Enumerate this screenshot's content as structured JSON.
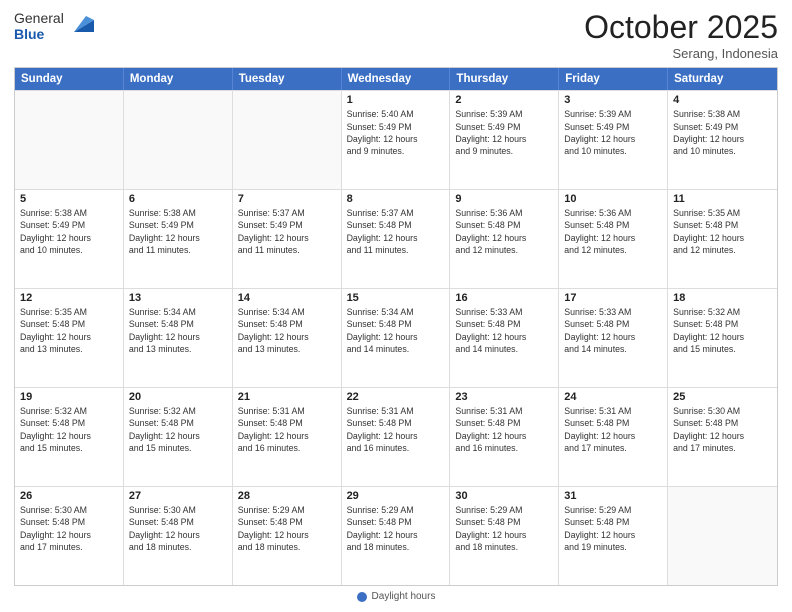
{
  "header": {
    "logo_general": "General",
    "logo_blue": "Blue",
    "month_title": "October 2025",
    "location": "Serang, Indonesia"
  },
  "days_of_week": [
    "Sunday",
    "Monday",
    "Tuesday",
    "Wednesday",
    "Thursday",
    "Friday",
    "Saturday"
  ],
  "footer": {
    "daylight_label": "Daylight hours"
  },
  "rows": [
    [
      {
        "day": "",
        "lines": []
      },
      {
        "day": "",
        "lines": []
      },
      {
        "day": "",
        "lines": []
      },
      {
        "day": "1",
        "lines": [
          "Sunrise: 5:40 AM",
          "Sunset: 5:49 PM",
          "Daylight: 12 hours",
          "and 9 minutes."
        ]
      },
      {
        "day": "2",
        "lines": [
          "Sunrise: 5:39 AM",
          "Sunset: 5:49 PM",
          "Daylight: 12 hours",
          "and 9 minutes."
        ]
      },
      {
        "day": "3",
        "lines": [
          "Sunrise: 5:39 AM",
          "Sunset: 5:49 PM",
          "Daylight: 12 hours",
          "and 10 minutes."
        ]
      },
      {
        "day": "4",
        "lines": [
          "Sunrise: 5:38 AM",
          "Sunset: 5:49 PM",
          "Daylight: 12 hours",
          "and 10 minutes."
        ]
      }
    ],
    [
      {
        "day": "5",
        "lines": [
          "Sunrise: 5:38 AM",
          "Sunset: 5:49 PM",
          "Daylight: 12 hours",
          "and 10 minutes."
        ]
      },
      {
        "day": "6",
        "lines": [
          "Sunrise: 5:38 AM",
          "Sunset: 5:49 PM",
          "Daylight: 12 hours",
          "and 11 minutes."
        ]
      },
      {
        "day": "7",
        "lines": [
          "Sunrise: 5:37 AM",
          "Sunset: 5:49 PM",
          "Daylight: 12 hours",
          "and 11 minutes."
        ]
      },
      {
        "day": "8",
        "lines": [
          "Sunrise: 5:37 AM",
          "Sunset: 5:48 PM",
          "Daylight: 12 hours",
          "and 11 minutes."
        ]
      },
      {
        "day": "9",
        "lines": [
          "Sunrise: 5:36 AM",
          "Sunset: 5:48 PM",
          "Daylight: 12 hours",
          "and 12 minutes."
        ]
      },
      {
        "day": "10",
        "lines": [
          "Sunrise: 5:36 AM",
          "Sunset: 5:48 PM",
          "Daylight: 12 hours",
          "and 12 minutes."
        ]
      },
      {
        "day": "11",
        "lines": [
          "Sunrise: 5:35 AM",
          "Sunset: 5:48 PM",
          "Daylight: 12 hours",
          "and 12 minutes."
        ]
      }
    ],
    [
      {
        "day": "12",
        "lines": [
          "Sunrise: 5:35 AM",
          "Sunset: 5:48 PM",
          "Daylight: 12 hours",
          "and 13 minutes."
        ]
      },
      {
        "day": "13",
        "lines": [
          "Sunrise: 5:34 AM",
          "Sunset: 5:48 PM",
          "Daylight: 12 hours",
          "and 13 minutes."
        ]
      },
      {
        "day": "14",
        "lines": [
          "Sunrise: 5:34 AM",
          "Sunset: 5:48 PM",
          "Daylight: 12 hours",
          "and 13 minutes."
        ]
      },
      {
        "day": "15",
        "lines": [
          "Sunrise: 5:34 AM",
          "Sunset: 5:48 PM",
          "Daylight: 12 hours",
          "and 14 minutes."
        ]
      },
      {
        "day": "16",
        "lines": [
          "Sunrise: 5:33 AM",
          "Sunset: 5:48 PM",
          "Daylight: 12 hours",
          "and 14 minutes."
        ]
      },
      {
        "day": "17",
        "lines": [
          "Sunrise: 5:33 AM",
          "Sunset: 5:48 PM",
          "Daylight: 12 hours",
          "and 14 minutes."
        ]
      },
      {
        "day": "18",
        "lines": [
          "Sunrise: 5:32 AM",
          "Sunset: 5:48 PM",
          "Daylight: 12 hours",
          "and 15 minutes."
        ]
      }
    ],
    [
      {
        "day": "19",
        "lines": [
          "Sunrise: 5:32 AM",
          "Sunset: 5:48 PM",
          "Daylight: 12 hours",
          "and 15 minutes."
        ]
      },
      {
        "day": "20",
        "lines": [
          "Sunrise: 5:32 AM",
          "Sunset: 5:48 PM",
          "Daylight: 12 hours",
          "and 15 minutes."
        ]
      },
      {
        "day": "21",
        "lines": [
          "Sunrise: 5:31 AM",
          "Sunset: 5:48 PM",
          "Daylight: 12 hours",
          "and 16 minutes."
        ]
      },
      {
        "day": "22",
        "lines": [
          "Sunrise: 5:31 AM",
          "Sunset: 5:48 PM",
          "Daylight: 12 hours",
          "and 16 minutes."
        ]
      },
      {
        "day": "23",
        "lines": [
          "Sunrise: 5:31 AM",
          "Sunset: 5:48 PM",
          "Daylight: 12 hours",
          "and 16 minutes."
        ]
      },
      {
        "day": "24",
        "lines": [
          "Sunrise: 5:31 AM",
          "Sunset: 5:48 PM",
          "Daylight: 12 hours",
          "and 17 minutes."
        ]
      },
      {
        "day": "25",
        "lines": [
          "Sunrise: 5:30 AM",
          "Sunset: 5:48 PM",
          "Daylight: 12 hours",
          "and 17 minutes."
        ]
      }
    ],
    [
      {
        "day": "26",
        "lines": [
          "Sunrise: 5:30 AM",
          "Sunset: 5:48 PM",
          "Daylight: 12 hours",
          "and 17 minutes."
        ]
      },
      {
        "day": "27",
        "lines": [
          "Sunrise: 5:30 AM",
          "Sunset: 5:48 PM",
          "Daylight: 12 hours",
          "and 18 minutes."
        ]
      },
      {
        "day": "28",
        "lines": [
          "Sunrise: 5:29 AM",
          "Sunset: 5:48 PM",
          "Daylight: 12 hours",
          "and 18 minutes."
        ]
      },
      {
        "day": "29",
        "lines": [
          "Sunrise: 5:29 AM",
          "Sunset: 5:48 PM",
          "Daylight: 12 hours",
          "and 18 minutes."
        ]
      },
      {
        "day": "30",
        "lines": [
          "Sunrise: 5:29 AM",
          "Sunset: 5:48 PM",
          "Daylight: 12 hours",
          "and 18 minutes."
        ]
      },
      {
        "day": "31",
        "lines": [
          "Sunrise: 5:29 AM",
          "Sunset: 5:48 PM",
          "Daylight: 12 hours",
          "and 19 minutes."
        ]
      },
      {
        "day": "",
        "lines": []
      }
    ]
  ]
}
